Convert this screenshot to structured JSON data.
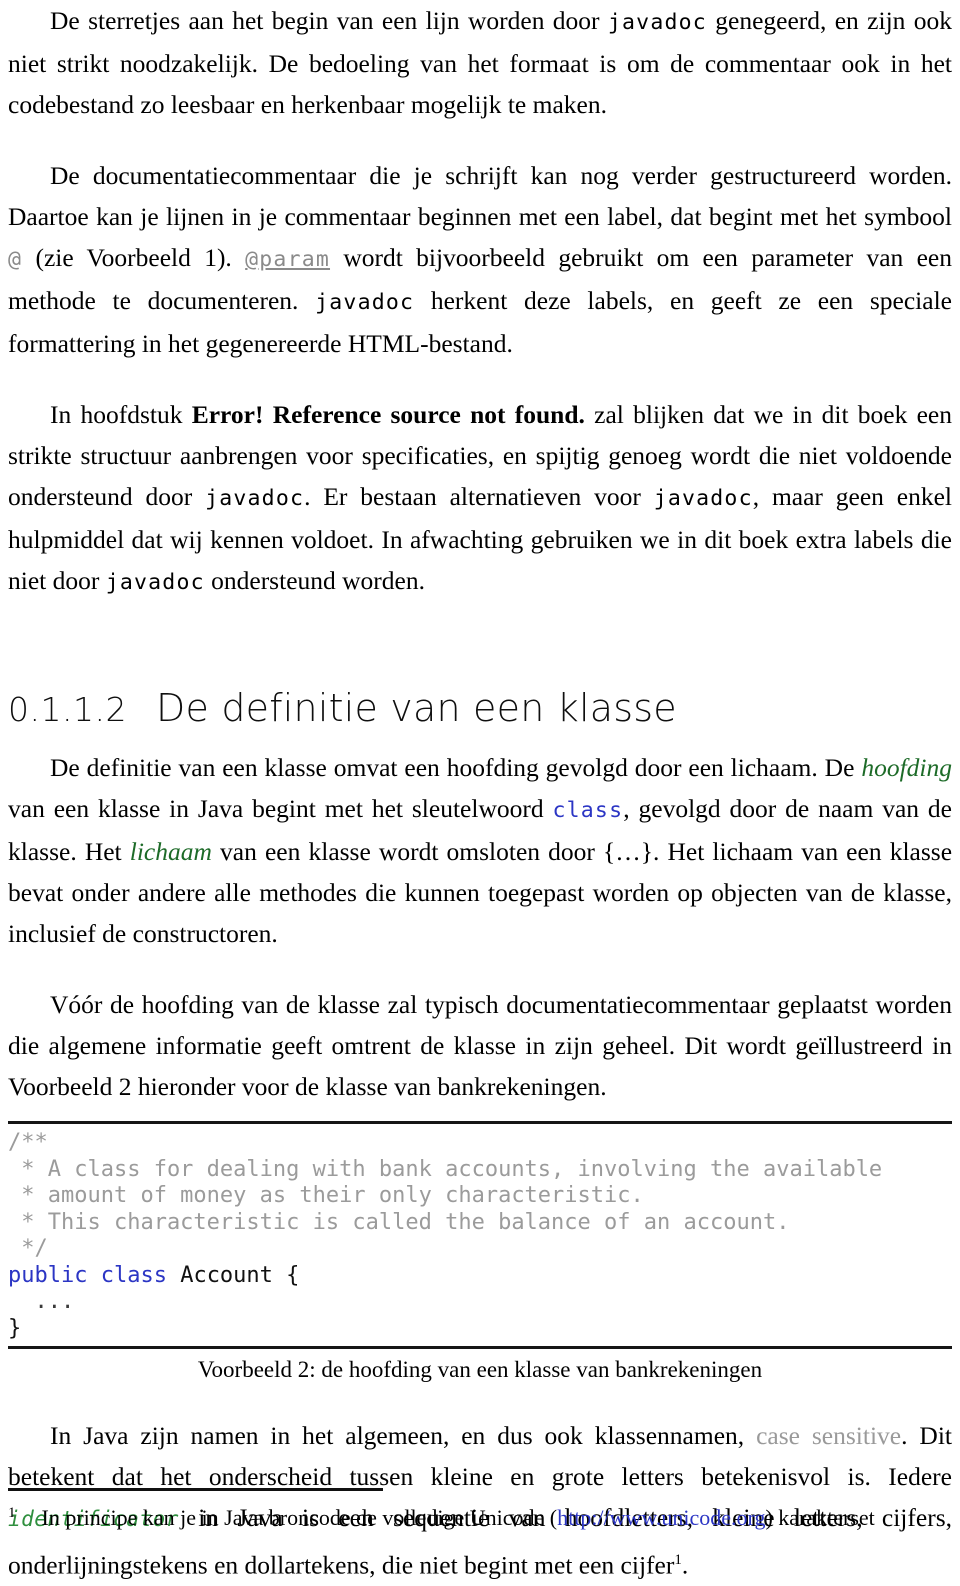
{
  "paragraphs": {
    "p1": {
      "a": "De sterretjes aan het begin van een lijn worden door ",
      "code1": "javadoc",
      "b": " genegeerd, en zijn ook niet strikt noodzakelijk. De bedoeling van het formaat is om de commentaar ook in het codebestand zo leesbaar en herkenbaar mogelijk te maken."
    },
    "p2": {
      "a": "De documentatiecommentaar die je schrijft kan nog verder gestructureerd worden. Daartoe kan je lijnen in je commentaar beginnen met een label, dat begint met het symbool ",
      "at": "@",
      "b": " (zie Voorbeeld 1). ",
      "param": "@param",
      "c": " wordt bijvoorbeeld gebruikt om een parameter van een methode te documenteren. ",
      "javadoc": "javadoc",
      "d": " herkent deze labels, en geeft ze een speciale formattering in het gegenereerde HTML-bestand."
    },
    "p3": {
      "a": "In hoofdstuk ",
      "error": "Error! Reference source not found.",
      "b": " zal blijken dat we in dit boek een strikte structuur aanbrengen voor specificaties, en spijtig genoeg wordt die niet voldoende ondersteund door ",
      "javadoc1": "javadoc",
      "c": ". Er bestaan alternatieven voor ",
      "javadoc2": "javadoc",
      "d": ", maar geen enkel hulpmiddel dat wij kennen voldoet. In afwachting gebruiken we in dit boek extra labels die niet door ",
      "javadoc3": "javadoc",
      "e": " ondersteund worden."
    },
    "p4": {
      "a": "De definitie van een klasse omvat een hoofding gevolgd door een lichaam. De ",
      "hoofding": "hoofding",
      "b": " van een klasse in Java begint met het sleutelwoord ",
      "class": "class",
      "c": ", gevolgd door de naam van de klasse. Het ",
      "lichaam": "lichaam",
      "d": " van een klasse wordt omsloten door {…}. Het lichaam van een klasse bevat onder andere alle methodes die kunnen toegepast worden op objecten van de klasse, inclusief de constructoren."
    },
    "p5": {
      "a": "Vóór de hoofding van de klasse zal typisch documentatiecommentaar geplaatst worden die algemene informatie geeft omtrent de klasse in zijn geheel. Dit wordt geïllustreerd in Voorbeeld 2 hieronder voor de klasse van bankrekeningen."
    },
    "p6": {
      "a": "In Java zijn namen in het algemeen, en dus ook klassennamen, ",
      "casesensitive": "case sensitive",
      "b": ". Dit betekent dat het onderscheid tussen kleine en grote letters betekenisvol is. Iedere ",
      "identificator": "identificator",
      "c": " in Java is een sequentie van hoofdletters, kleine letters, cijfers, onderlijningstekens en dollartekens, die niet begint met een cijfer",
      "fnref": "1",
      "d": "."
    }
  },
  "heading": {
    "number": "0.1.1.2",
    "title": "De definitie van een klasse"
  },
  "code_block": {
    "lines": [
      {
        "comment": "/**"
      },
      {
        "comment": " * A class for dealing with bank accounts, involving the available"
      },
      {
        "comment": " * amount of money as their only characteristic."
      },
      {
        "comment": " * This characteristic is called the balance of an account."
      },
      {
        "comment": " */"
      }
    ],
    "decl_keyword": "public class",
    "decl_rest": " Account {",
    "body_dots": "  ...",
    "closing_brace": "}"
  },
  "caption": "Voorbeeld 2: de hoofding van een klasse van bankrekeningen",
  "footnote": {
    "mark": "1",
    "a": "In principe kan je in Java broncode de volledige Unicode (",
    "link": "http://www.unicode.org",
    "b": ") karakterset"
  },
  "colors": {
    "code_keyword_blue": "#2b35c4",
    "code_comment_grey": "#9b9b9b",
    "emphasis_green": "#1d6b28",
    "identifier_green": "#2f8f3e",
    "muted_grey": "#9a9a9a",
    "link_blue": "#2b35c4",
    "text_black": "#000000"
  }
}
